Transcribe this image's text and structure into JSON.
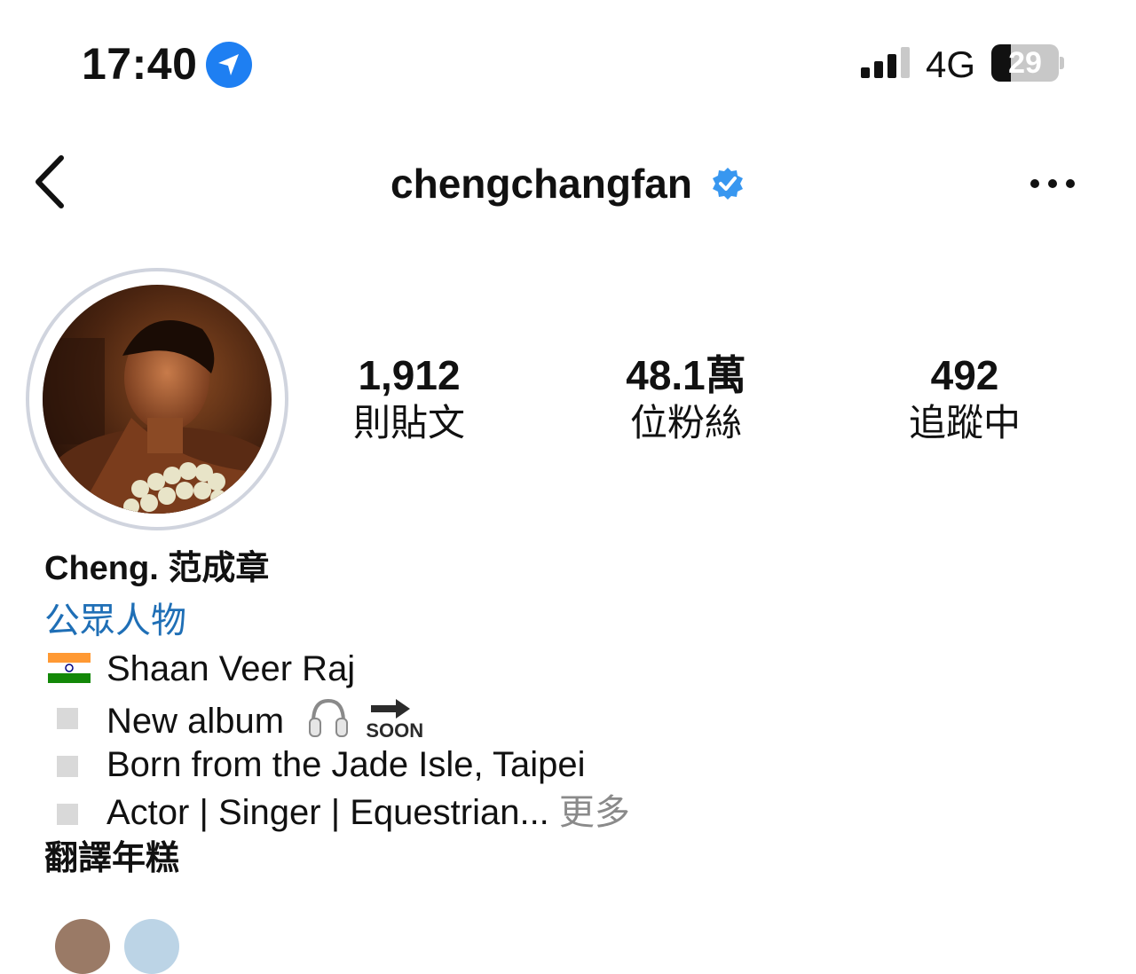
{
  "status_bar": {
    "time": "17:40",
    "network": "4G",
    "battery": "29",
    "battery_level_percent": 29,
    "location_icon": "location-arrow-icon",
    "signal_icon": "cellular-signal-icon"
  },
  "header": {
    "username": "chengchangfan",
    "verified_icon": "verified-badge-icon",
    "back_icon": "chevron-left-icon",
    "more_icon": "more-dots-icon"
  },
  "stats": [
    {
      "value": "1,912",
      "label": "則貼文"
    },
    {
      "value": "48.1萬",
      "label": "位粉絲"
    },
    {
      "value": "492",
      "label": "追蹤中"
    }
  ],
  "bio": {
    "full_name": "Cheng. 范成章",
    "category": "公眾人物",
    "lines": [
      {
        "icon": "india-flag-icon",
        "text": "Shaan Veer Raj"
      },
      {
        "icon": "square-bullet-icon",
        "text": "New album",
        "emoji": [
          "headphones-icon",
          "soon-arrow-icon"
        ],
        "soon": "SOON"
      },
      {
        "icon": "square-bullet-icon",
        "text": "Born from the Jade Isle, Taipei"
      },
      {
        "icon": "square-bullet-icon",
        "text": "Actor | Singer | Equestrian...",
        "more": "更多"
      }
    ],
    "translate": "翻譯年糕"
  },
  "colors": {
    "accent_blue": "#1f6fb6",
    "verified_blue": "#3897f0",
    "location_blue": "#1e7ff2",
    "muted_gray": "#8a8a8a"
  }
}
